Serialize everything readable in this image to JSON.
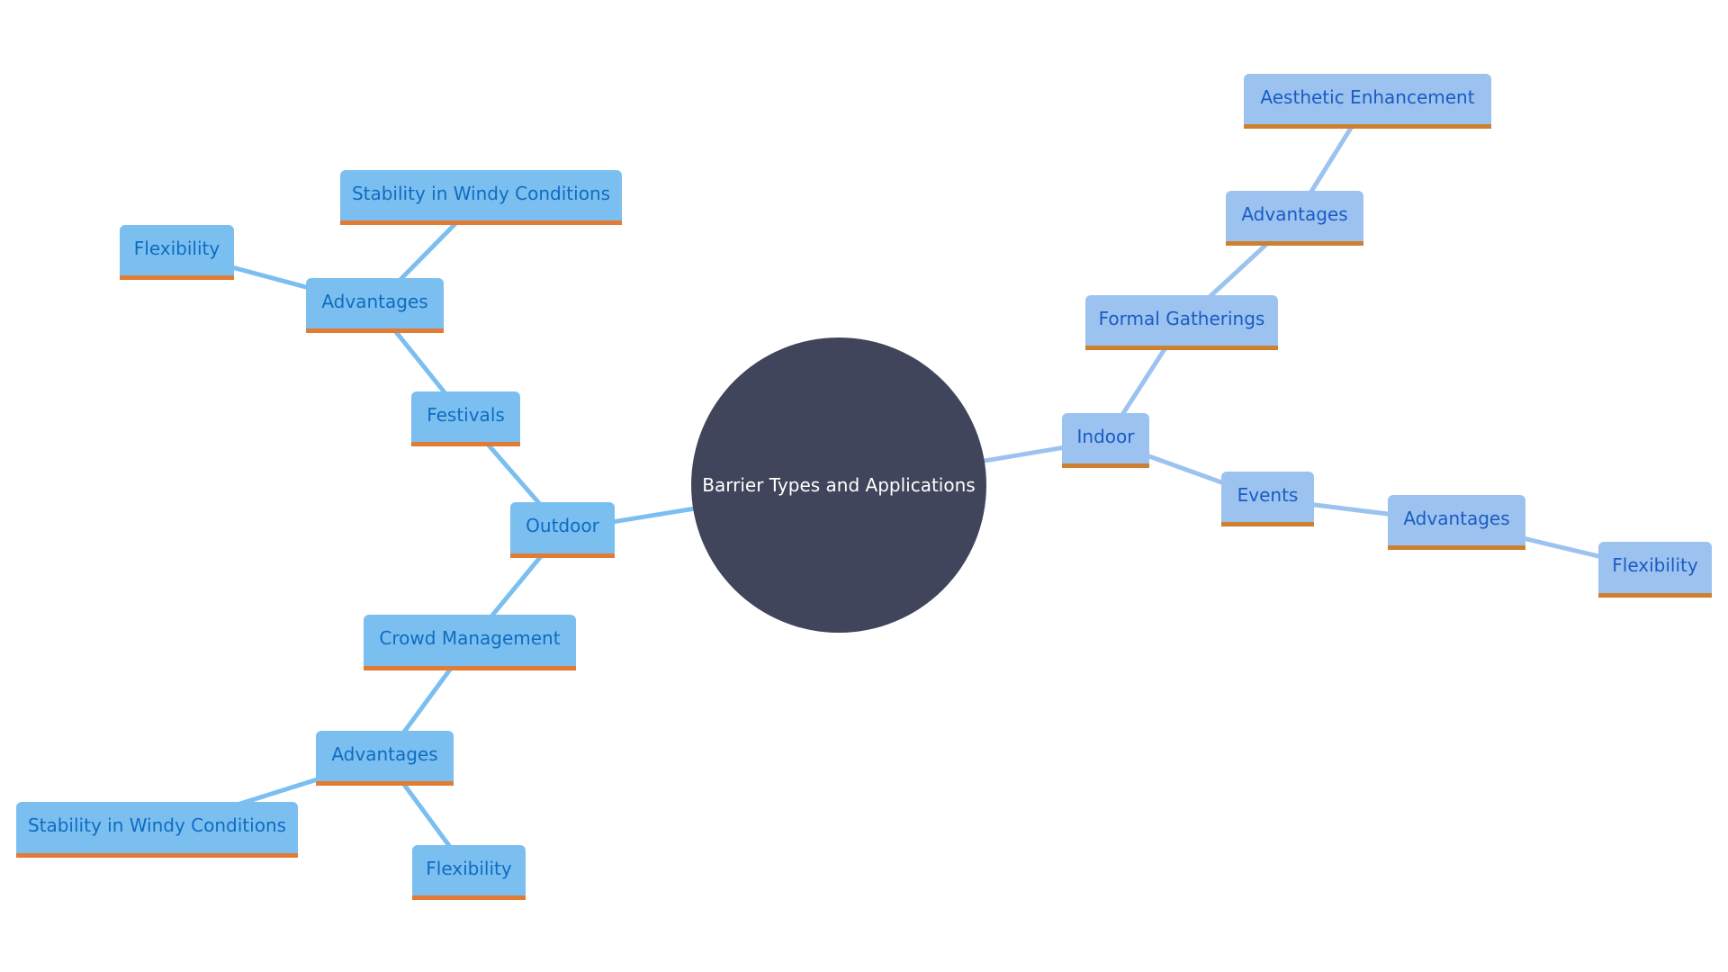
{
  "diagram": {
    "type": "mind-map",
    "root": {
      "label": "Barrier Types and Applications"
    },
    "nodes": {
      "outdoor": {
        "label": "Outdoor"
      },
      "festivals": {
        "label": "Festivals"
      },
      "festivals_advantages": {
        "label": "Advantages"
      },
      "festivals_stability": {
        "label": "Stability in Windy Conditions"
      },
      "festivals_flexibility": {
        "label": "Flexibility"
      },
      "crowd_management": {
        "label": "Crowd Management"
      },
      "crowd_advantages": {
        "label": "Advantages"
      },
      "crowd_stability": {
        "label": "Stability in Windy Conditions"
      },
      "crowd_flexibility": {
        "label": "Flexibility"
      },
      "indoor": {
        "label": "Indoor"
      },
      "formal_gatherings": {
        "label": "Formal Gatherings"
      },
      "formal_advantages": {
        "label": "Advantages"
      },
      "formal_aesthetic": {
        "label": "Aesthetic Enhancement"
      },
      "events": {
        "label": "Events"
      },
      "events_advantages": {
        "label": "Advantages"
      },
      "events_flexibility": {
        "label": "Flexibility"
      }
    },
    "edges": [
      [
        "root",
        "outdoor"
      ],
      [
        "outdoor",
        "festivals"
      ],
      [
        "festivals",
        "festivals_advantages"
      ],
      [
        "festivals_advantages",
        "festivals_stability"
      ],
      [
        "festivals_advantages",
        "festivals_flexibility"
      ],
      [
        "outdoor",
        "crowd_management"
      ],
      [
        "crowd_management",
        "crowd_advantages"
      ],
      [
        "crowd_advantages",
        "crowd_stability"
      ],
      [
        "crowd_advantages",
        "crowd_flexibility"
      ],
      [
        "root",
        "indoor"
      ],
      [
        "indoor",
        "formal_gatherings"
      ],
      [
        "formal_gatherings",
        "formal_advantages"
      ],
      [
        "formal_advantages",
        "formal_aesthetic"
      ],
      [
        "indoor",
        "events"
      ],
      [
        "events",
        "events_advantages"
      ],
      [
        "events_advantages",
        "events_flexibility"
      ]
    ],
    "colors": {
      "root_fill": "#41455c",
      "outdoor_fill": "#7bbff1",
      "outdoor_text": "#0f6cbf",
      "outdoor_accent": "#e27b34",
      "indoor_fill": "#9cc3ef",
      "indoor_text": "#1a5bc4",
      "indoor_accent": "#cd8130"
    }
  }
}
